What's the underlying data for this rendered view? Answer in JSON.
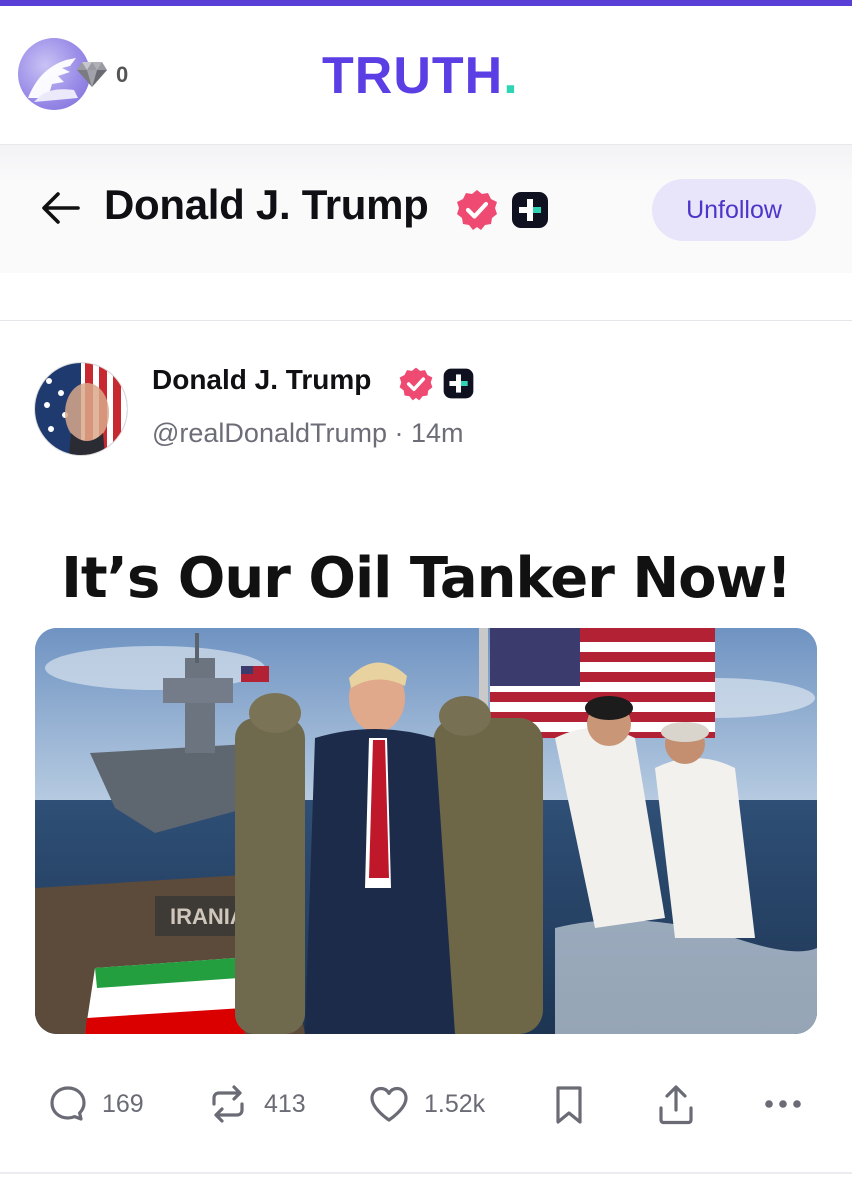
{
  "app": {
    "brand_name": "TRUTH",
    "brand_dot": ".",
    "gem_count": "0"
  },
  "header": {
    "title": "Donald J. Trump",
    "follow_button": "Unfollow"
  },
  "post": {
    "author_name": "Donald J. Trump",
    "handle": "@realDonaldTrump",
    "time": "· 14m",
    "title_text": "It’s Our Oil Tanker Now!",
    "image_text": "IRANIA"
  },
  "actions": {
    "replies": "169",
    "retruths": "413",
    "likes": "1.52k"
  },
  "icons": [
    "back-arrow-icon",
    "verified-badge-icon",
    "plus-badge-icon",
    "gem-icon",
    "reply-icon",
    "retruth-icon",
    "like-icon",
    "bookmark-icon",
    "share-icon",
    "more-icon"
  ],
  "colors": {
    "accent": "#5b3fe4",
    "brand_dot": "#2fd4b4",
    "verified": "#ee4a72",
    "button_bg": "#e8e5fb",
    "muted_text": "#6d6d78"
  }
}
